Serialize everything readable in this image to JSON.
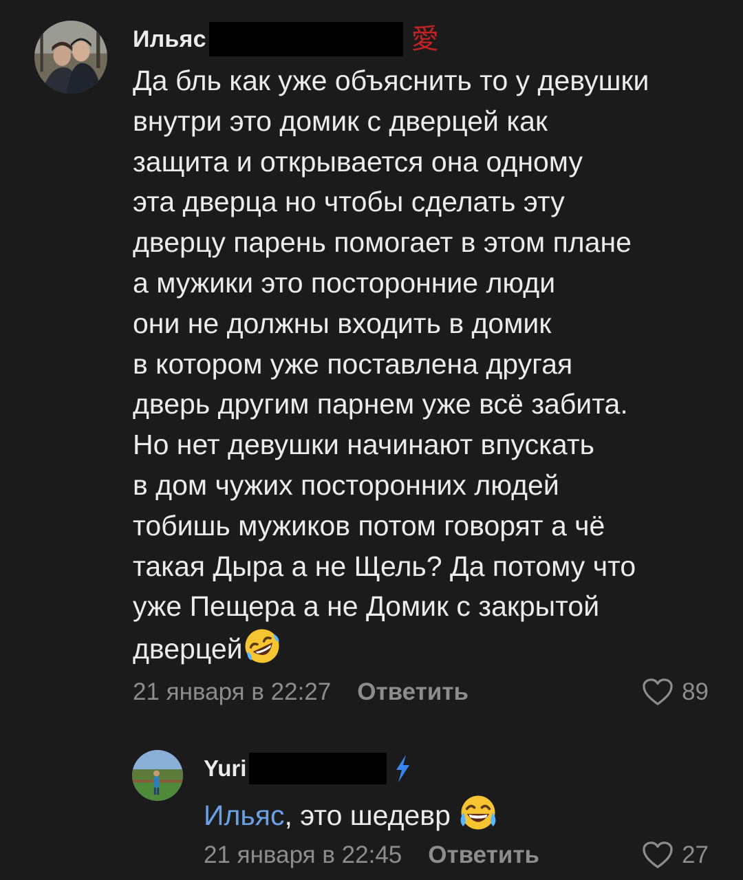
{
  "comments": [
    {
      "author": "Ильяс",
      "badge_text": "愛",
      "text": "Да бль как уже объяснить то у девушки\nвнутри это домик с дверцей как\nзащита и открывается она одному\nэта дверца но чтобы сделать эту\nдверцу парень помогает в этом плане\nа мужики это посторонние люди\nони не должны входить в домик\nв котором уже поставлена другая\nдверь другим парнем уже всё забита.\nНо нет девушки начинают впускать\nв дом чужих посторонних людей\nтобишь мужиков потом говорят а чё\nтакая Дыра а не Щель? Да потому что\nуже Пещера а не Домик с закрытой\nдверцей",
      "emoji": "rolling-on-floor-laughing",
      "timestamp": "21 января в 22:27",
      "reply_label": "Ответить",
      "likes": "89"
    },
    {
      "author": "Yuri",
      "badge_icon": "lightning-icon",
      "mention": "Ильяс",
      "text": ", это шедевр ",
      "emoji": "face-with-tears-of-joy",
      "timestamp": "21 января в 22:45",
      "reply_label": "Ответить",
      "likes": "27"
    }
  ],
  "colors": {
    "background": "#1b1b1b",
    "text": "#ececec",
    "muted": "#8d8d8d",
    "mention": "#6aa1e6",
    "badge_red": "#c42222",
    "lightning_blue": "#3a86f0"
  }
}
